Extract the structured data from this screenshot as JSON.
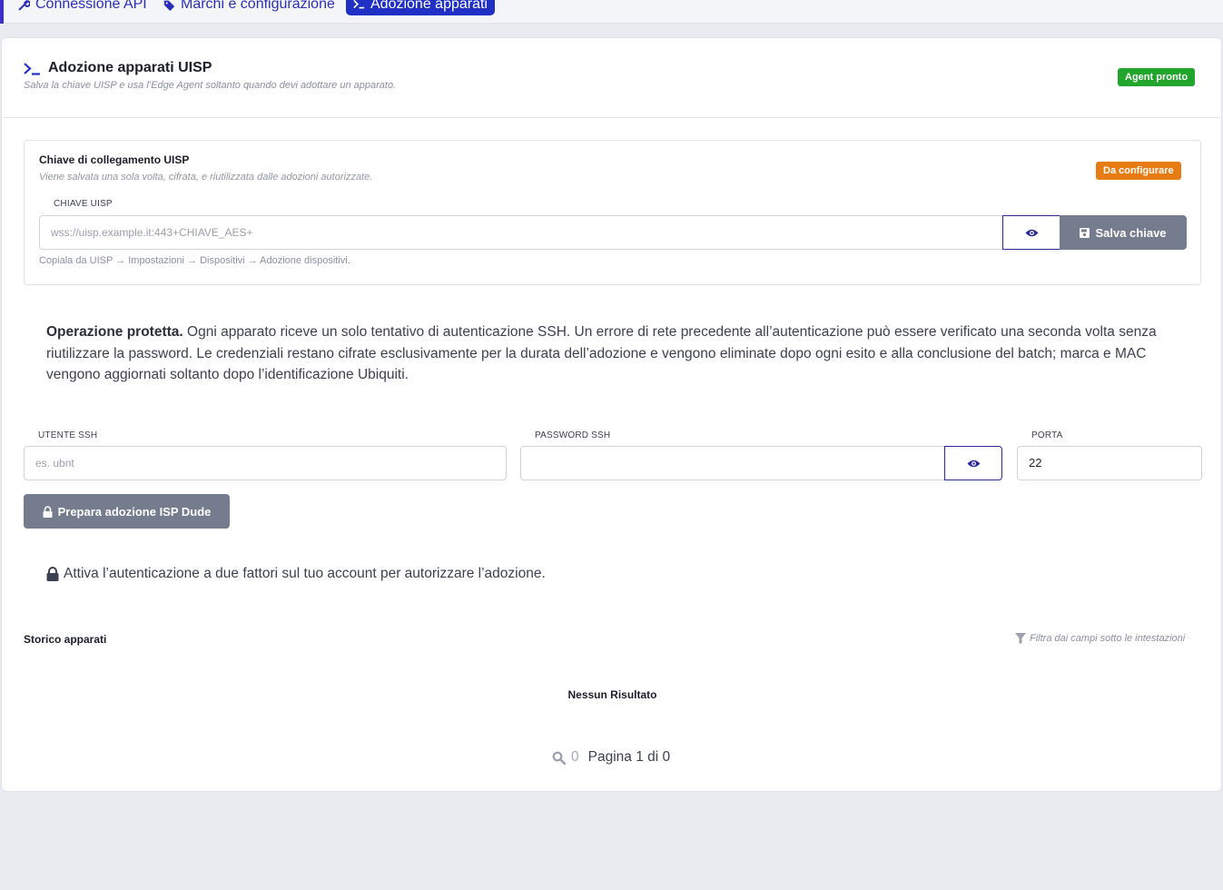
{
  "tabs": [
    {
      "label": "Connessione API",
      "icon": "wrench-icon",
      "active": false
    },
    {
      "label": "Marchi e configurazione",
      "icon": "tag-icon",
      "active": false
    },
    {
      "label": "Adozione apparati",
      "icon": "terminal-icon",
      "active": true
    }
  ],
  "header": {
    "title": "Adozione apparati UISP",
    "subtitle": "Salva la chiave UISP e usa l’Edge Agent soltanto quando devi adottare un apparato.",
    "status_badge": "Agent pronto",
    "colors": {
      "badge": "#22a52c"
    }
  },
  "key_section": {
    "title": "Chiave di collegamento UISP",
    "subtitle": "Viene salvata una sola volta, cifrata, e riutilizzata dalle adozioni autorizzate.",
    "badge": "Da configurare",
    "field_label": "CHIAVE UISP",
    "placeholder": "wss://uisp.example.it:443+CHIAVE_AES+",
    "save_label": "Salva chiave",
    "hint": "Copiala da UISP → Impostazioni → Dispositivi → Adozione dispositivi.",
    "colors": {
      "badge": "#e87c14"
    }
  },
  "notice": {
    "bold": "Operazione protetta.",
    "text": " Ogni apparato riceve un solo tentativo di autenticazione SSH. Un errore di rete precedente all’autenticazione può essere verificato una seconda volta senza riutilizzare la password. Le credenziali restano cifrate esclusivamente per la durata dell’adozione e vengono eliminate dopo ogni esito e alla conclusione del batch; marca e MAC vengono aggiornati soltanto dopo l’identificazione Ubiquiti."
  },
  "ssh": {
    "user_label": "UTENTE SSH",
    "user_placeholder": "es. ubnt",
    "password_label": "PASSWORD SSH",
    "password_value": "",
    "port_label": "PORTA",
    "port_value": "22",
    "prepare_label": "Prepara adozione ISP Dude"
  },
  "twofa_text": "Attiva l’autenticazione a due fattori sul tuo account per autorizzare l’adozione.",
  "history": {
    "title": "Storico apparati",
    "filter_hint": "Filtra dai campi sotto le intestazioni",
    "empty": "Nessun Risultato",
    "count": "0",
    "page_text": "Pagina 1 di 0"
  }
}
